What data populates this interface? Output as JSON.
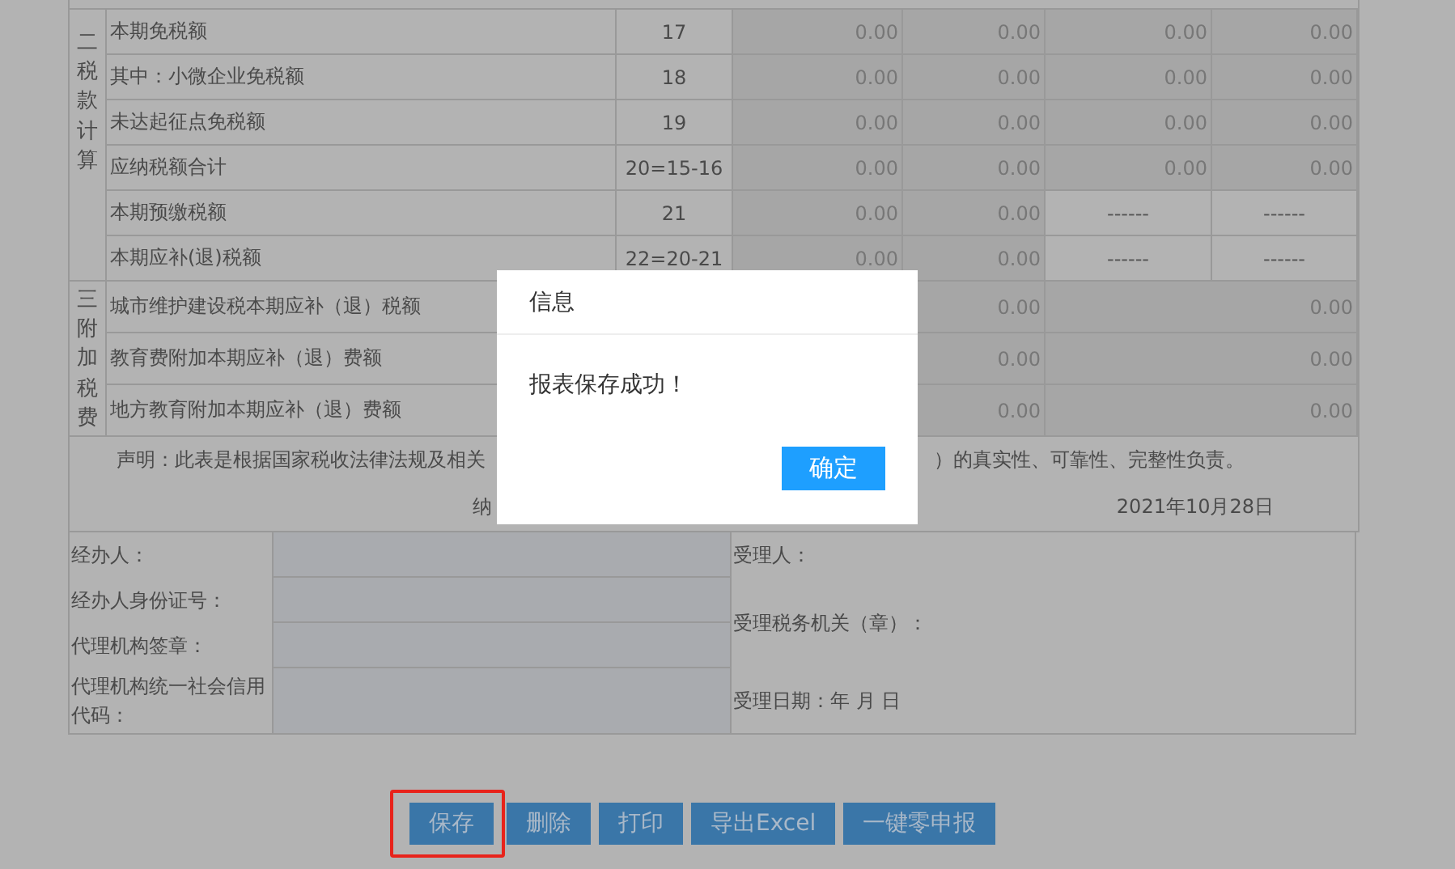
{
  "tax_section": {
    "heading": "二税款计算",
    "rows": [
      {
        "label": "本期免税额",
        "line": "17",
        "cells": [
          {
            "text": "0.00",
            "kind": "amount"
          },
          {
            "text": "0.00",
            "kind": "amount"
          },
          {
            "text": "0.00",
            "kind": "amount"
          },
          {
            "text": "0.00",
            "kind": "amount"
          }
        ]
      },
      {
        "label": "其中：小微企业免税额",
        "line": "18",
        "cells": [
          {
            "text": "0.00",
            "kind": "amount"
          },
          {
            "text": "0.00",
            "kind": "amount"
          },
          {
            "text": "0.00",
            "kind": "amount"
          },
          {
            "text": "0.00",
            "kind": "amount"
          }
        ]
      },
      {
        "label": "未达起征点免税额",
        "line": "19",
        "cells": [
          {
            "text": "0.00",
            "kind": "amount"
          },
          {
            "text": "0.00",
            "kind": "amount"
          },
          {
            "text": "0.00",
            "kind": "amount"
          },
          {
            "text": "0.00",
            "kind": "amount"
          }
        ]
      },
      {
        "label": "应纳税额合计",
        "line": "20=15-16",
        "cells": [
          {
            "text": "0.00",
            "kind": "amount"
          },
          {
            "text": "0.00",
            "kind": "amount"
          },
          {
            "text": "0.00",
            "kind": "amount"
          },
          {
            "text": "0.00",
            "kind": "amount"
          }
        ]
      },
      {
        "label": "本期预缴税额",
        "line": "21",
        "cells": [
          {
            "text": "0.00",
            "kind": "amount"
          },
          {
            "text": "0.00",
            "kind": "amount"
          },
          {
            "text": "------",
            "kind": "na"
          },
          {
            "text": "------",
            "kind": "na"
          }
        ]
      },
      {
        "label": "本期应补(退)税额",
        "line": "22=20-21",
        "cells": [
          {
            "text": "0.00",
            "kind": "amount"
          },
          {
            "text": "0.00",
            "kind": "amount"
          },
          {
            "text": "------",
            "kind": "na"
          },
          {
            "text": "------",
            "kind": "na"
          }
        ]
      }
    ]
  },
  "surcharge_section": {
    "heading": "三附加税费",
    "rows": [
      {
        "label": "城市维护建设税本期应补（退）税额",
        "amounts": [
          "0.00",
          "0.00"
        ]
      },
      {
        "label": "教育费附加本期应补（退）费额",
        "amounts": [
          "0.00",
          "0.00"
        ]
      },
      {
        "label": "地方教育附加本期应补（退）费额",
        "amounts": [
          "0.00",
          "0.00"
        ]
      }
    ]
  },
  "declaration": {
    "text_start": "声明：此表是根据国家税收法律法规及相关",
    "text_end": "）的真实性、可靠性、完整性负责。",
    "signer": "纳",
    "date": "2021年10月28日"
  },
  "agent": {
    "fields": [
      "经办人：",
      "经办人身份证号：",
      "代理机构签章：",
      "代理机构统一社会信用代码："
    ],
    "receiver": [
      "受理人：",
      "受理税务机关（章）：",
      "受理日期：年 月 日"
    ]
  },
  "buttons": [
    {
      "label": "保存",
      "highlighted": true
    },
    {
      "label": "删除",
      "highlighted": false
    },
    {
      "label": "打印",
      "highlighted": false
    },
    {
      "label": "导出Excel",
      "highlighted": false
    },
    {
      "label": "一键零申报",
      "highlighted": false
    }
  ],
  "dialog": {
    "title": "信息",
    "message": "报表保存成功！",
    "button": "确定"
  }
}
